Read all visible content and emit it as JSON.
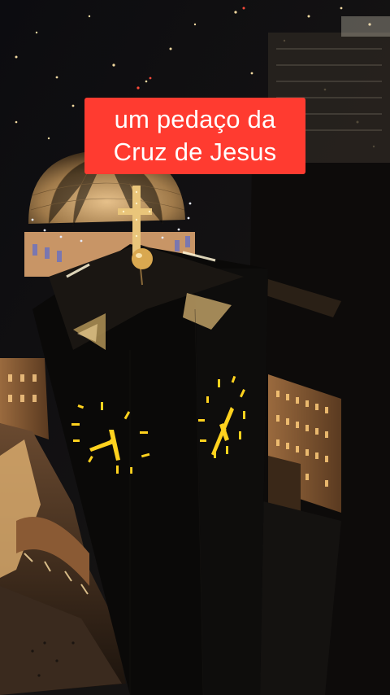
{
  "caption": {
    "line1": "um pedaço da",
    "line2": "Cruz de Jesus"
  },
  "colors": {
    "caption_background": "#ff3b30",
    "caption_text": "#ffffff",
    "night_sky": "#050403",
    "clock_glow": "#ffd21e",
    "dome_gold": "#c9a06a"
  },
  "scene": {
    "description_icons": [
      "tower-clock",
      "golden-cross",
      "dome"
    ]
  }
}
